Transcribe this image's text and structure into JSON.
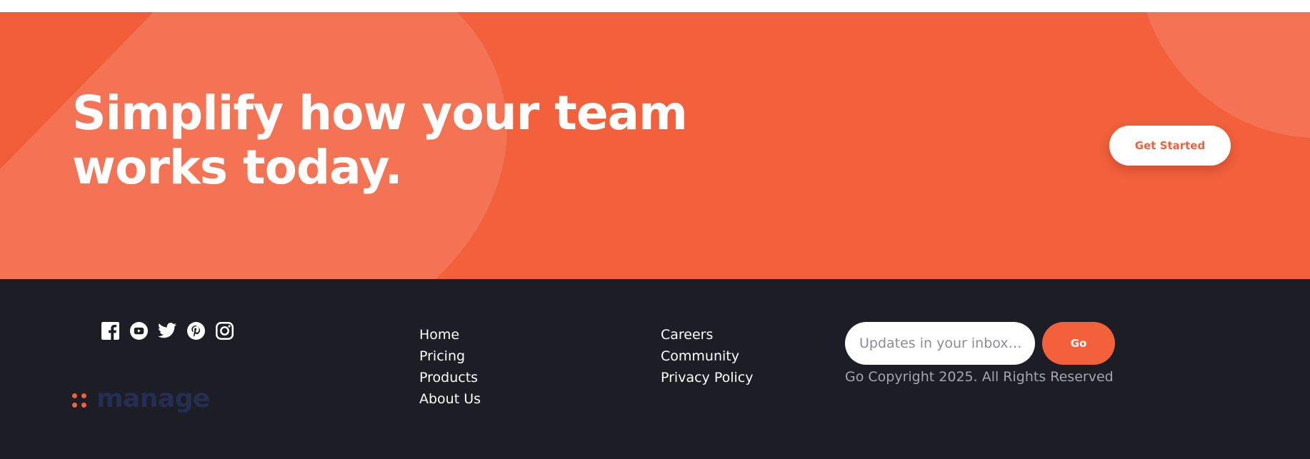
{
  "colors": {
    "brand_orange": "#f2603c",
    "footer_bg": "#1d1e25",
    "logo_text": "#242d52",
    "copyright_text": "#a4a6ae"
  },
  "cta": {
    "title_line1": "Simplify how your team",
    "title_line2": "works today.",
    "button_label": "Get Started"
  },
  "footer": {
    "social_icons": [
      "facebook-icon",
      "youtube-icon",
      "twitter-icon",
      "pinterest-icon",
      "instagram-icon"
    ],
    "logo_text": "manage",
    "nav_col_1": [
      "Home",
      "Pricing",
      "Products",
      "About Us"
    ],
    "nav_col_2": [
      "Careers",
      "Community",
      "Privacy Policy"
    ],
    "newsletter": {
      "placeholder": "Updates in your inbox…",
      "button_label": "Go"
    },
    "copyright": "Go Copyright 2025. All Rights Reserved"
  }
}
